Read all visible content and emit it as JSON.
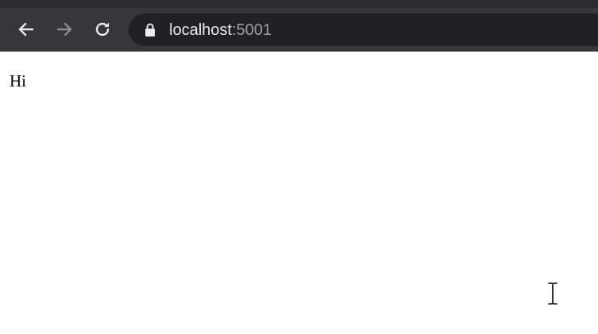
{
  "browser": {
    "url": {
      "host": "localhost",
      "port": ":5001"
    },
    "icons": {
      "back": "arrow-left-icon",
      "forward": "arrow-right-icon",
      "reload": "reload-icon",
      "lock": "lock-icon"
    },
    "forward_enabled": false
  },
  "page": {
    "text": "Hi"
  },
  "cursor": "text-cursor-icon",
  "colors": {
    "toolbar": "#36373a",
    "omnibox": "#202124",
    "url_host": "#e8eaed",
    "url_port": "#9aa0a6",
    "page_background": "#ffffff"
  }
}
